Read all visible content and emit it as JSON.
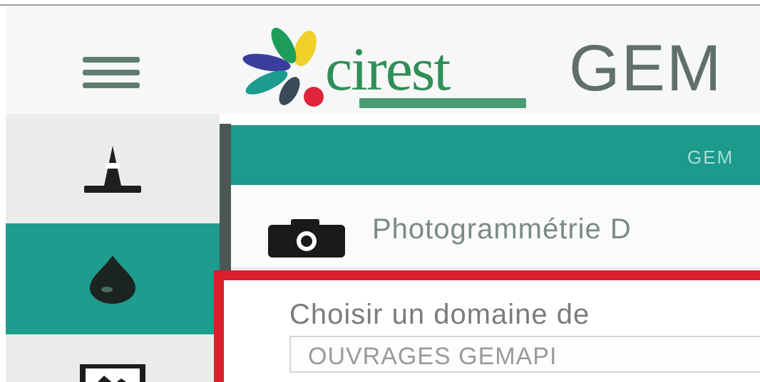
{
  "app": {
    "title": "GEM"
  },
  "logo": {
    "word": "cirest",
    "tagline": "",
    "colors": {
      "petal_green": "#1e9c5a",
      "petal_blue": "#3a3f9e",
      "petal_yellow": "#f0d12a",
      "petal_red": "#e0243a",
      "petal_teal": "#1d9b8e",
      "petal_grey": "#3b4a5a"
    }
  },
  "header": {
    "menu_icon": "hamburger-menu-icon"
  },
  "sidebar": {
    "items": [
      {
        "icon": "traffic-cone-icon",
        "active": false
      },
      {
        "icon": "water-drop-icon",
        "active": true
      },
      {
        "icon": "image-icon",
        "active": false
      }
    ]
  },
  "panel": {
    "header_text": "GEM",
    "photo_icon": "camera-icon",
    "photo_label": "Photogrammétrie D"
  },
  "selector": {
    "label": "Choisir un domaine de",
    "value": "OUVRAGES GEMAPI"
  },
  "colors": {
    "accent": "#1e9c8e",
    "highlight": "#d81f2a",
    "menu": "#5f7e70"
  }
}
